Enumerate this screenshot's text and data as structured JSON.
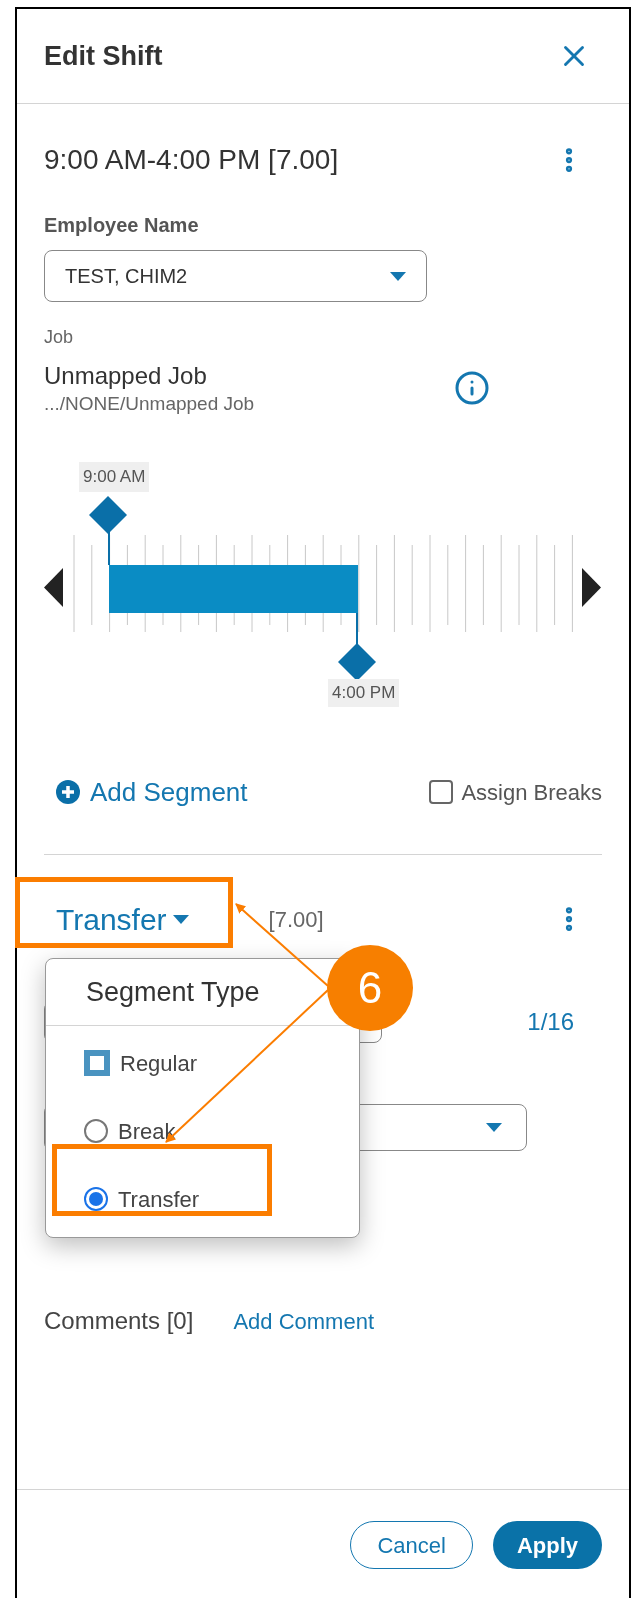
{
  "header": {
    "title": "Edit Shift"
  },
  "shift": {
    "time_range": "9:00 AM-4:00 PM [7.00]",
    "employee_label": "Employee Name",
    "employee_value": "TEST, CHIM2",
    "job_label": "Job",
    "job_name": "Unmapped Job",
    "job_path": ".../NONE/Unmapped Job"
  },
  "timeline": {
    "start_label": "9:00 AM",
    "end_label": "4:00 PM"
  },
  "actions": {
    "add_segment": "Add Segment",
    "assign_breaks": {
      "label": "Assign Breaks",
      "checked": false
    }
  },
  "segment": {
    "type_label": "Transfer",
    "hours": "[7.00]",
    "count": "1/16"
  },
  "segment_type_menu": {
    "title": "Segment Type",
    "options": [
      {
        "label": "Regular",
        "kind": "square",
        "selected": false
      },
      {
        "label": "Break",
        "kind": "radio",
        "selected": false
      },
      {
        "label": "Transfer",
        "kind": "radio",
        "selected": true
      }
    ]
  },
  "comments": {
    "label": "Comments [0]",
    "add_link": "Add Comment"
  },
  "footer": {
    "buttons": [
      {
        "label": "Cancel",
        "kind": "secondary"
      },
      {
        "label": "Apply",
        "kind": "primary"
      }
    ]
  },
  "annotation": {
    "number": "6"
  }
}
